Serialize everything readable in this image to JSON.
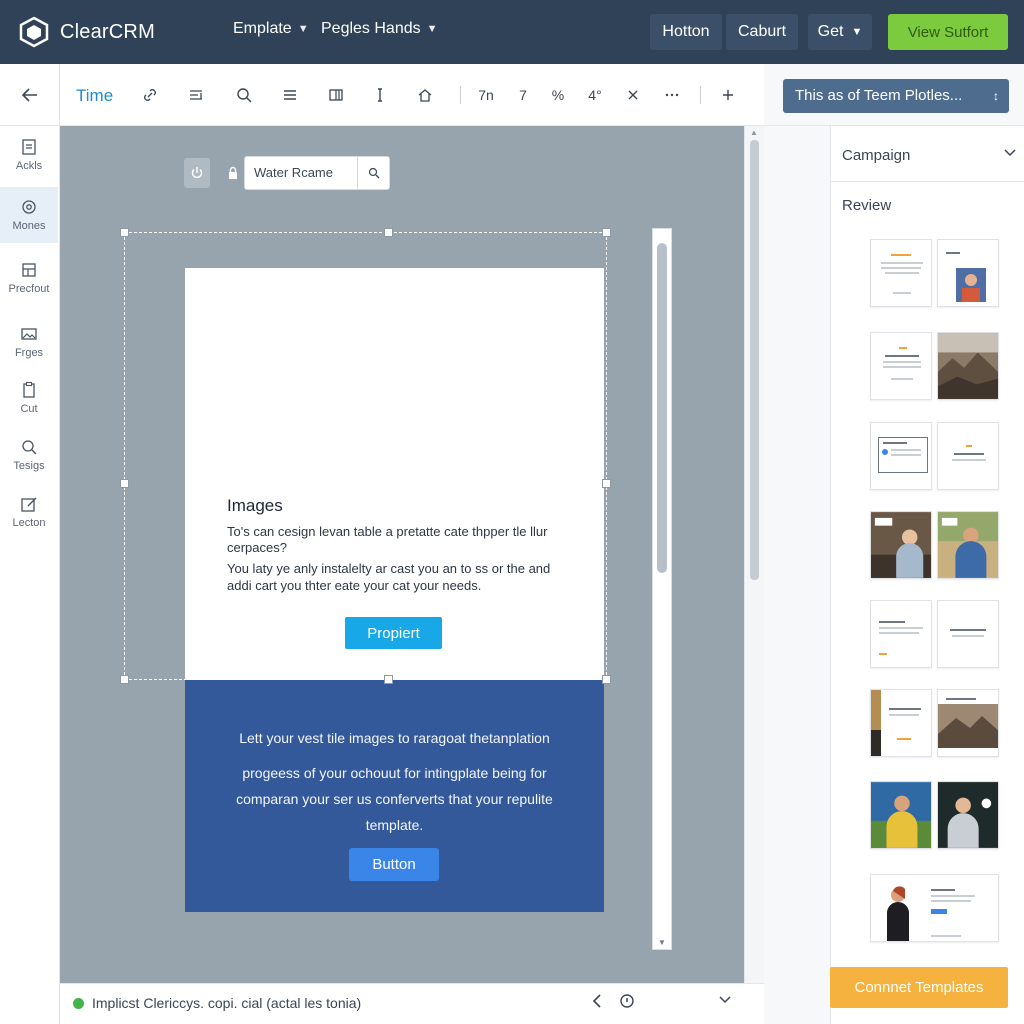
{
  "app": {
    "name": "ClearCRM"
  },
  "topbar": {
    "nav": [
      {
        "label": "Emplate"
      },
      {
        "label": "Pegles Hands"
      }
    ],
    "buttons": [
      {
        "label": "Hotton"
      },
      {
        "label": "Caburt"
      },
      {
        "label": "Get"
      }
    ],
    "primary_label": "View Sutfort"
  },
  "sidebar": {
    "items": [
      {
        "label": "Ackls",
        "icon": "document-icon"
      },
      {
        "label": "Mones",
        "icon": "gear-icon",
        "active": true
      },
      {
        "label": "Precfout",
        "icon": "layout-icon"
      },
      {
        "label": "Frges",
        "icon": "image-icon"
      },
      {
        "label": "Cut",
        "icon": "clipboard-icon"
      },
      {
        "label": "Tesigs",
        "icon": "search-settings-icon"
      },
      {
        "label": "Lecton",
        "icon": "edit-icon"
      }
    ]
  },
  "toolbar": {
    "title": "Time",
    "text_tools": [
      "7n",
      "7",
      "%",
      "4°"
    ]
  },
  "frame": {
    "name": "Water Rcame"
  },
  "email": {
    "heading": "Images",
    "para1": "To's can cesign levan table a pretatte cate thpper tle llur cerpaces?",
    "para2": "You laty ye anly instalelty ar cast you an to ss or the and addi cart you thter eate your cat your needs.",
    "cta_label": "Propiert",
    "blue_lines": [
      "Lett your vest tile images to raragoat thetanplation",
      "progeess of your ochouut for intingplate being for",
      "comparan your ser us conferverts that your repulite",
      "template."
    ],
    "blue_button": "Button"
  },
  "status": {
    "text": "Implicst Clericcys. copi. cial (actal les tonia)"
  },
  "right_panel": {
    "select_label": "This as of Teem Plotles...",
    "campaign_label": "Campaign",
    "review_label": "Review",
    "convert_label": "Connnet Templates"
  },
  "colors": {
    "topbar": "#2f4258",
    "accent_blue": "#1c8bd0",
    "primary_green": "#7ccb3e",
    "email_band": "#34599b",
    "cta": "#18a8e8",
    "convert": "#f6b23f",
    "status_dot": "#46b24a"
  }
}
